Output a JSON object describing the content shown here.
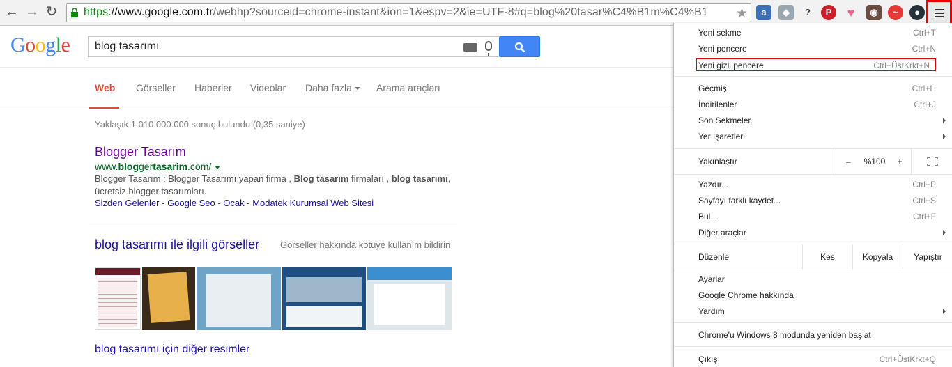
{
  "browser": {
    "url_https": "https",
    "url_host": "://www.google.com.tr",
    "url_rest": "/webhp?sourceid=chrome-instant&ion=1&espv=2&ie=UTF-8#q=blog%20tasar%C4%B1m%C4%B1"
  },
  "google": {
    "logo": "Google",
    "query": "blog tasarımı",
    "tabs": [
      "Web",
      "Görseller",
      "Haberler",
      "Videolar",
      "Daha fazla",
      "Arama araçları"
    ],
    "result_stats": "Yaklaşık 1.010.000.000 sonuç bulundu (0,35 saniye)",
    "result1": {
      "title": "Blogger Tasarım",
      "url_prefix": "www.",
      "url_b1": "blog",
      "url_mid": "ger",
      "url_b2": "tasarim",
      "url_suffix": ".com/",
      "snippet_1": "Blogger Tasarım : Blogger Tasarımı yapan firma , ",
      "snippet_b1": "Blog tasarım",
      "snippet_2": " firmaları , ",
      "snippet_b2": "blog tasarımı",
      "snippet_3": ", ücretsiz blogger tasarımları.",
      "sitelinks": [
        "Sizden Gelenler",
        "Google Seo",
        "Ocak",
        "Modatek Kurumsal Web Sitesi"
      ],
      "sitelink_sep": " - "
    },
    "images_title": "blog tasarımı ile ilgili görseller",
    "images_report": "Görseller hakkında kötüye kullanım bildirin",
    "more_images": "blog tasarımı için diğer resimler"
  },
  "menu": {
    "new_tab": {
      "label": "Yeni sekme",
      "shortcut": "Ctrl+T"
    },
    "new_window": {
      "label": "Yeni pencere",
      "shortcut": "Ctrl+N"
    },
    "incognito": {
      "label": "Yeni gizli pencere",
      "shortcut": "Ctrl+ÜstKrkt+N"
    },
    "history": {
      "label": "Geçmiş",
      "shortcut": "Ctrl+H"
    },
    "downloads": {
      "label": "İndirilenler",
      "shortcut": "Ctrl+J"
    },
    "recent_tabs": {
      "label": "Son Sekmeler"
    },
    "bookmarks": {
      "label": "Yer İşaretleri"
    },
    "zoom": {
      "label": "Yakınlaştır",
      "minus": "–",
      "value": "%100",
      "plus": "+"
    },
    "print": {
      "label": "Yazdır...",
      "shortcut": "Ctrl+P"
    },
    "save_as": {
      "label": "Sayfayı farklı kaydet...",
      "shortcut": "Ctrl+S"
    },
    "find": {
      "label": "Bul...",
      "shortcut": "Ctrl+F"
    },
    "more_tools": {
      "label": "Diğer araçlar"
    },
    "edit": {
      "label": "Düzenle",
      "cut": "Kes",
      "copy": "Kopyala",
      "paste": "Yapıştır"
    },
    "settings": {
      "label": "Ayarlar"
    },
    "about": {
      "label": "Google Chrome hakkında"
    },
    "help": {
      "label": "Yardım"
    },
    "relaunch": {
      "label": "Chrome'u Windows 8 modunda yeniden başlat"
    },
    "exit": {
      "label": "Çıkış",
      "shortcut": "Ctrl+ÜstKrkt+Q"
    }
  },
  "colors": {
    "accent_red": "#dd4b39",
    "link_blue": "#1a0dab",
    "visited": "#660099",
    "url_green": "#006621",
    "search_blue": "#4285f4"
  }
}
